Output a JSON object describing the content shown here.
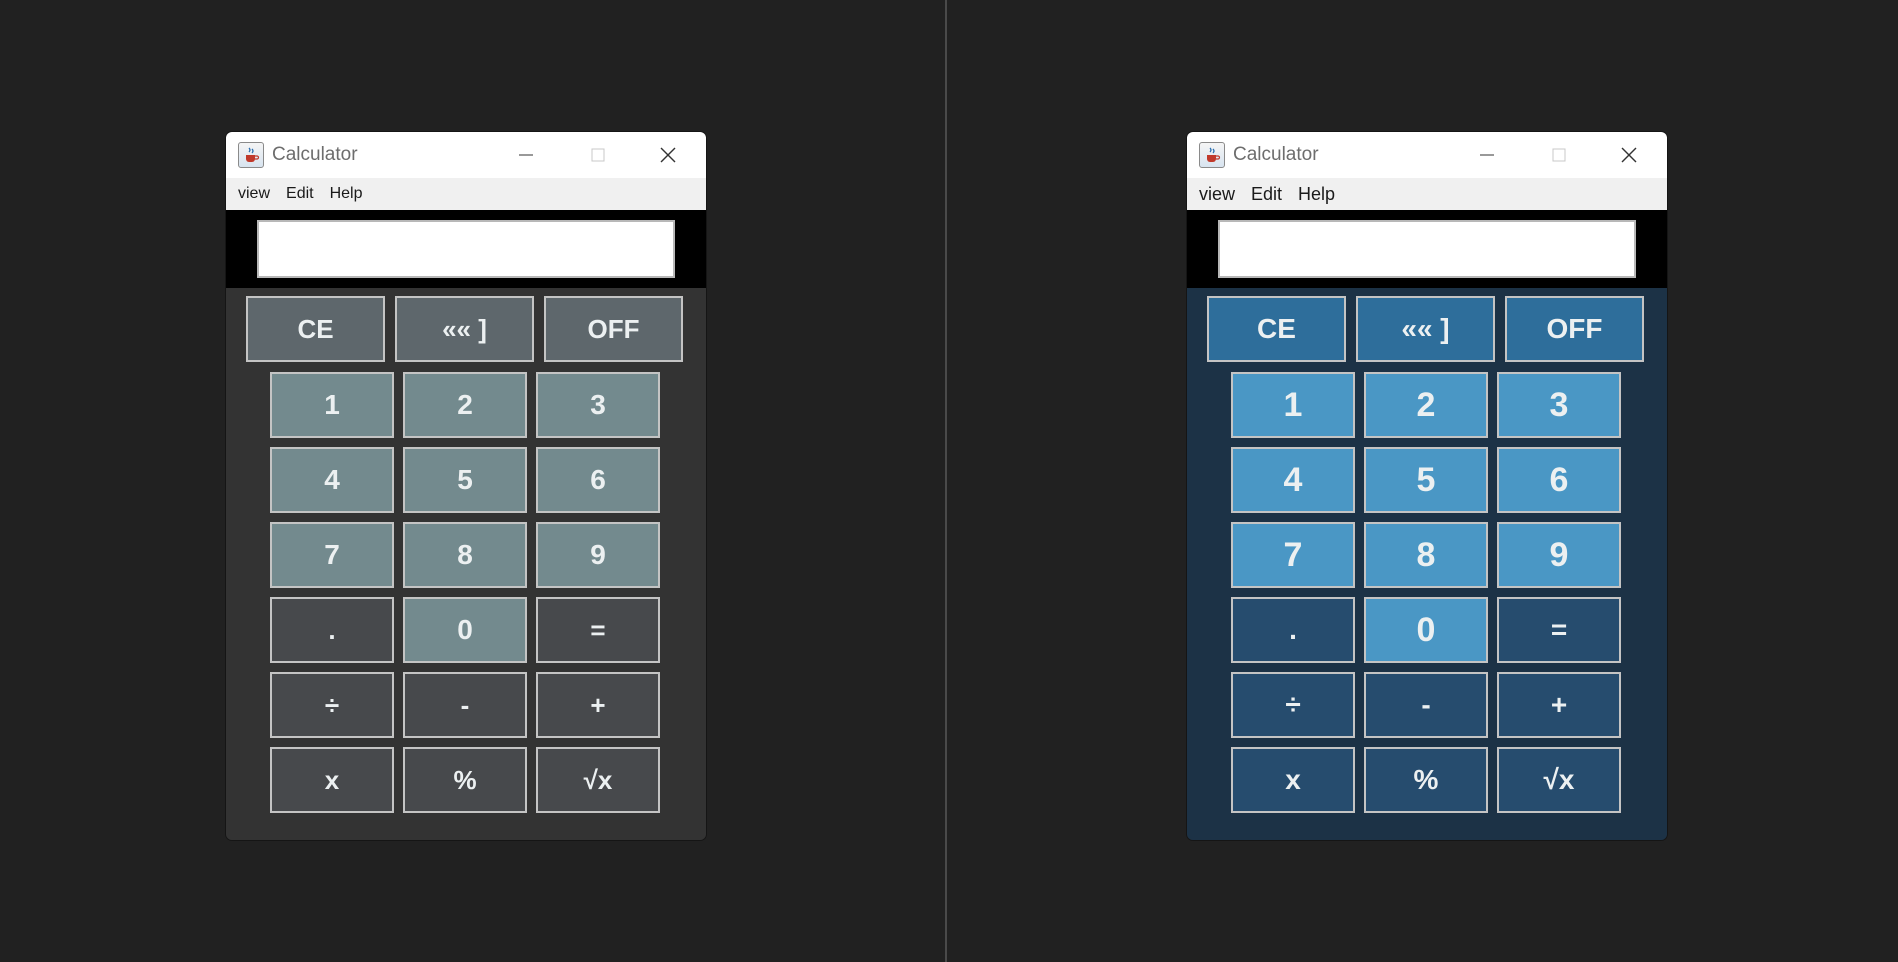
{
  "windows": [
    {
      "id": "left",
      "title": "Calculator",
      "menu": [
        "view",
        "Edit",
        "Help"
      ],
      "display_value": "",
      "colors": {
        "body": "#333333",
        "top_buttons": "#5e676c",
        "number_buttons": "#738a8e",
        "operator_buttons": "#47494c"
      }
    },
    {
      "id": "right",
      "title": "Calculator",
      "menu": [
        "view",
        "Edit",
        "Help"
      ],
      "display_value": "",
      "colors": {
        "body": "#1c3246",
        "top_buttons": "#2e6e9b",
        "number_buttons": "#4a97c5",
        "operator_buttons": "#264c6e"
      }
    }
  ],
  "buttons": {
    "top": [
      "CE",
      "«« ]",
      "OFF"
    ],
    "rows": [
      [
        "1",
        "2",
        "3"
      ],
      [
        "4",
        "5",
        "6"
      ],
      [
        "7",
        "8",
        "9"
      ],
      [
        ".",
        "0",
        "="
      ],
      [
        "÷",
        "-",
        "+"
      ],
      [
        "x",
        "%",
        "√x"
      ]
    ]
  },
  "icons": {
    "app": "java-cup-icon",
    "minimize": "minimize-icon",
    "maximize": "maximize-icon",
    "close": "close-icon"
  }
}
